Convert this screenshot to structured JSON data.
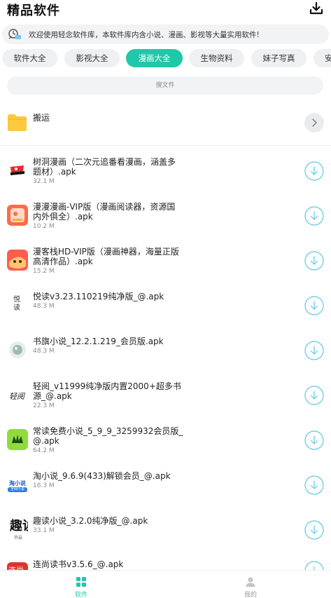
{
  "header": {
    "title": "精品软件",
    "download_icon": "download-icon"
  },
  "notice": {
    "text": "欢迎使用轻念软件库，本软件库内含小说、漫画、影视等大量实用软件!",
    "icon": "announcement-icon"
  },
  "tabs": [
    {
      "label": "软件大全",
      "active": false
    },
    {
      "label": "影视大全",
      "active": false
    },
    {
      "label": "漫画大全",
      "active": true
    },
    {
      "label": "生物资料",
      "active": false
    },
    {
      "label": "妹子写真",
      "active": false
    },
    {
      "label": "安",
      "active": false
    }
  ],
  "search": {
    "placeholder": "搜文件"
  },
  "folder": {
    "name": "搬运"
  },
  "files": [
    {
      "name": "树洞漫画（二次元追番看漫画，涵盖多题材）.apk",
      "size": "32.1 M"
    },
    {
      "name": "漫漫漫画-VIP版（漫画阅读器，资源国内外俱全）.apk",
      "size": "10.2 M"
    },
    {
      "name": "漫客栈HD-VIP版（漫画神器，海量正版高清作品）.apk",
      "size": "15.2 M"
    },
    {
      "name": "悦读v3.23.110219纯净版_@.apk",
      "size": "48.3 M"
    },
    {
      "name": "书旗小说_12.2.1.219_会员版.apk",
      "size": "48.3 M"
    },
    {
      "name": "轻阅_v11999纯净版内置2000+超多书源_@.apk",
      "size": "22.3 M"
    },
    {
      "name": "常读免费小说_5_9_9_3259932会员版_@.apk",
      "size": "64.2 M"
    },
    {
      "name": "淘小说_9.6.9(433)解锁会员_@.apk",
      "size": "16.3 M"
    },
    {
      "name": "趣读小说_3.2.0纯净版_@.apk",
      "size": "33.1 M"
    },
    {
      "name": "连尚读书v3.5.6_@.apk",
      "size": ""
    }
  ],
  "icon_text": {
    "yuedu": "悦读",
    "qingyue": "轻阅",
    "taoxiaoshuo": "淘小说",
    "taoxiaoshuo_sub": "全网小说",
    "qudu": "趣读",
    "qudu_sub": "开启",
    "lianshang": "连尚"
  },
  "bottom_nav": [
    {
      "label": "软件",
      "active": true,
      "icon": "apps-grid-icon"
    },
    {
      "label": "我的",
      "active": false,
      "icon": "user-icon"
    }
  ],
  "colors": {
    "accent": "#1fc8a8",
    "folder": "#fcc93f",
    "download_ring": "#5bc8e8"
  }
}
